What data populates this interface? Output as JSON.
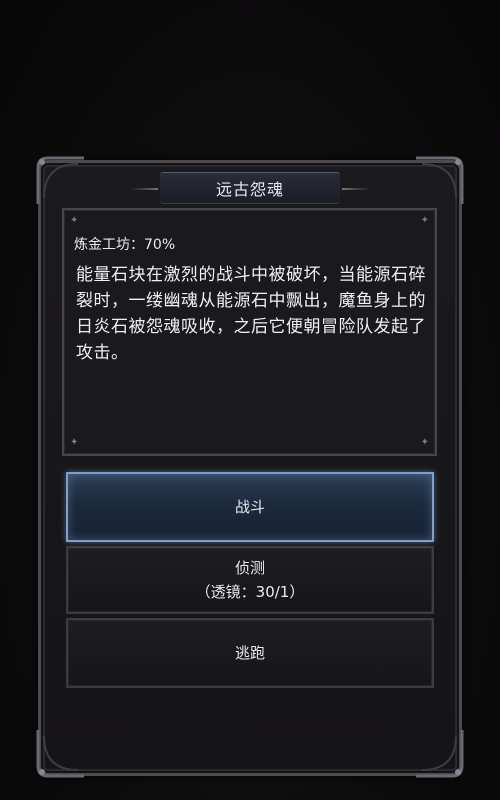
{
  "dialog": {
    "title": "远古怨魂",
    "alchemy_label": "炼金工坊：70%",
    "description": "能量石块在激烈的战斗中被破坏，当能源石碎裂时，一缕幽魂从能源石中飘出，魔鱼身上的日炎石被怨魂吸收，之后它便朝冒险队发起了攻击。"
  },
  "actions": {
    "fight_label": "战斗",
    "scout_label": "侦测",
    "scout_cost": "（透镜：30/1）",
    "flee_label": "逃跑"
  },
  "colors": {
    "background": "#0c0b0c",
    "frame": "#4e4a50",
    "selected_button_border": "#7fa0c8",
    "selected_button_fill": "#1c2a3d",
    "text": "#f1eff3"
  }
}
